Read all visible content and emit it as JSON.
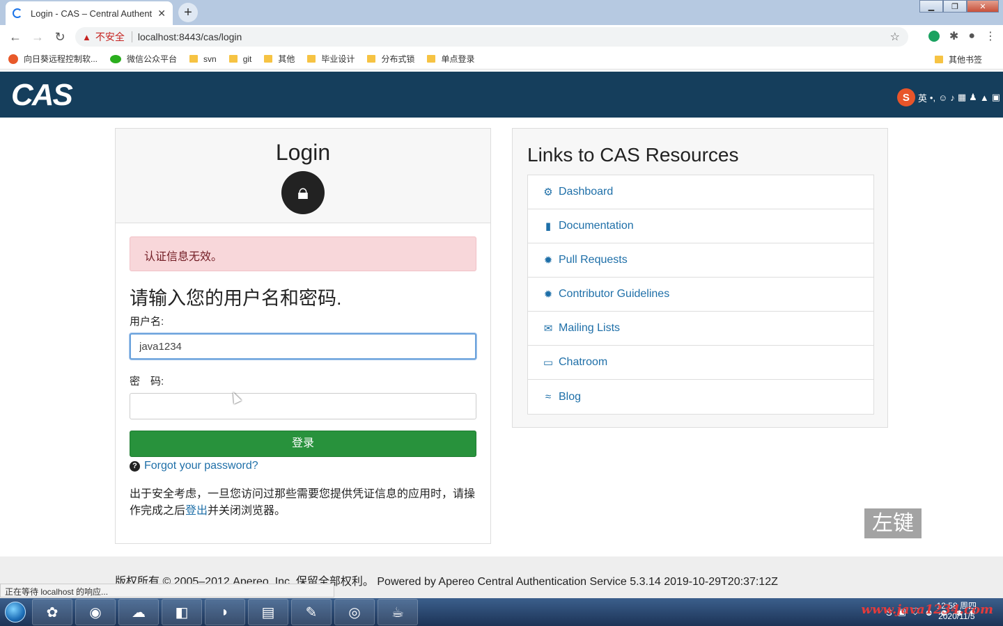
{
  "browser": {
    "tab_title": "Login - CAS – Central Authent",
    "tab_close": "✕",
    "new_tab": "+",
    "insecure_label": "不安全",
    "url": "localhost:8443/cas/login",
    "bookmarks": [
      "向日葵远程控制软...",
      "微信公众平台",
      "svn",
      "git",
      "其他",
      "毕业设计",
      "分布式锁",
      "单点登录"
    ],
    "other_bookmarks": "其他书签",
    "status_text": "正在等待 localhost 的响应..."
  },
  "header": {
    "logo": "CAS",
    "ime_label": "英"
  },
  "login": {
    "title": "Login",
    "error": "认证信息无效。",
    "prompt": "请输入您的用户名和密码.",
    "username_label": "用户名:",
    "username_value": "java1234",
    "password_label": "密　码:",
    "submit": "登录",
    "forgot": "Forgot your password?",
    "notice_before": "出于安全考虑，一旦您访问过那些需要您提供凭证信息的应用时，请操作完成之后",
    "notice_link": "登出",
    "notice_after": "并关闭浏览器。"
  },
  "resources": {
    "title": "Links to CAS Resources",
    "items": [
      {
        "label": "Dashboard",
        "icon": "gears-icon"
      },
      {
        "label": "Documentation",
        "icon": "file-icon"
      },
      {
        "label": "Pull Requests",
        "icon": "bug-icon"
      },
      {
        "label": "Contributor Guidelines",
        "icon": "bug-icon"
      },
      {
        "label": "Mailing Lists",
        "icon": "envelope-icon"
      },
      {
        "label": "Chatroom",
        "icon": "comment-icon"
      },
      {
        "label": "Blog",
        "icon": "rss-icon"
      }
    ]
  },
  "hint_overlay": "左键",
  "footer": {
    "text": "版权所有 © 2005–2012 Apereo, Inc. 保留全部权利。 Powered by Apereo Central Authentication Service 5.3.14 2019-10-29T20:37:12Z"
  },
  "taskbar": {
    "clock_time": "12:58 周四",
    "clock_date": "2020/11/5",
    "watermark": "www.java1234.com"
  },
  "colors": {
    "header_bg": "#153e5c",
    "login_button": "#28923c",
    "link": "#1e6fa8",
    "alert_bg": "#f8d7da"
  }
}
